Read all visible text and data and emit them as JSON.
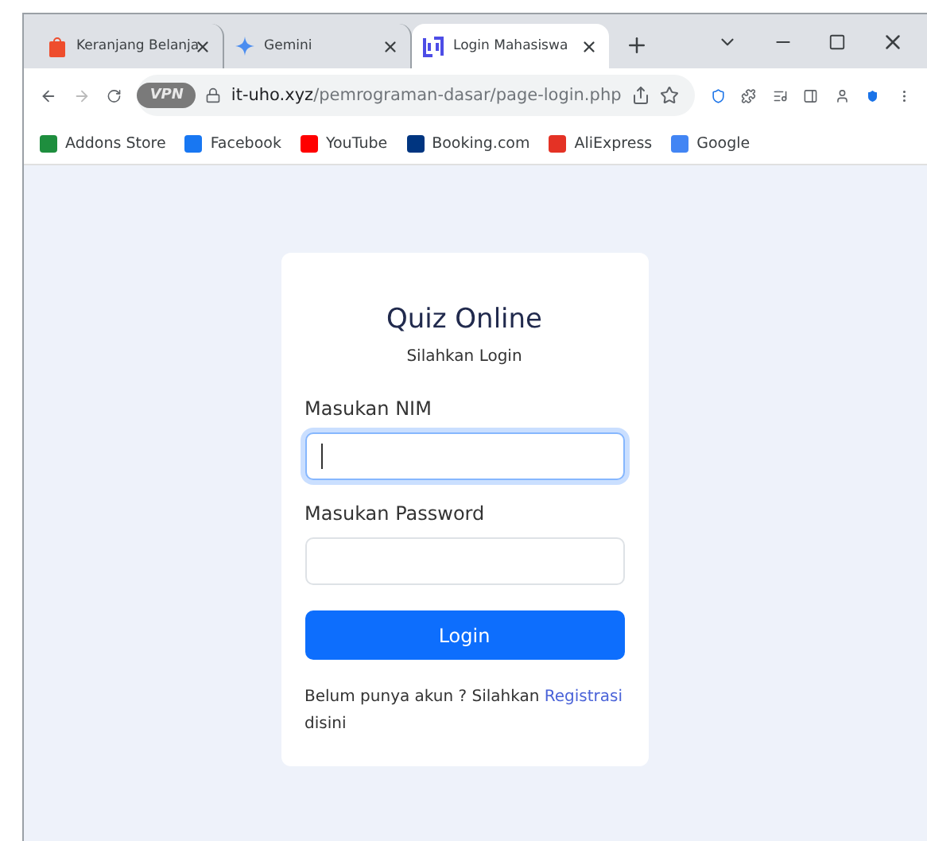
{
  "tabs": [
    {
      "title": "Keranjang Belanja",
      "kind": "shop",
      "selected": false
    },
    {
      "title": "Gemini",
      "kind": "star",
      "selected": false
    },
    {
      "title": "Login Mahasiswa",
      "kind": "logo",
      "selected": true
    }
  ],
  "toolbar": {
    "vpn_badge": "VPN",
    "url_domain": "it-uho.xyz",
    "url_path": "/pemrograman-dasar/page-login.php"
  },
  "bookmarks": [
    {
      "label": "Addons Store",
      "color": "#1e8e3e"
    },
    {
      "label": "Facebook",
      "color": "#1877f2"
    },
    {
      "label": "YouTube",
      "color": "#ff0000"
    },
    {
      "label": "Booking.com",
      "color": "#003580"
    },
    {
      "label": "AliExpress",
      "color": "#e43225"
    },
    {
      "label": "Google",
      "color": "#4285f4"
    }
  ],
  "login": {
    "title": "Quiz Online",
    "subtitle": "Silahkan Login",
    "fields": [
      {
        "label": "Masukan NIM",
        "focused": true
      },
      {
        "label": "Masukan Password",
        "focused": false
      }
    ],
    "button": "Login",
    "footer_text": "Belum punya akun ? Silahkan ",
    "footer_link": "Registrasi",
    "footer_after": " disini"
  }
}
